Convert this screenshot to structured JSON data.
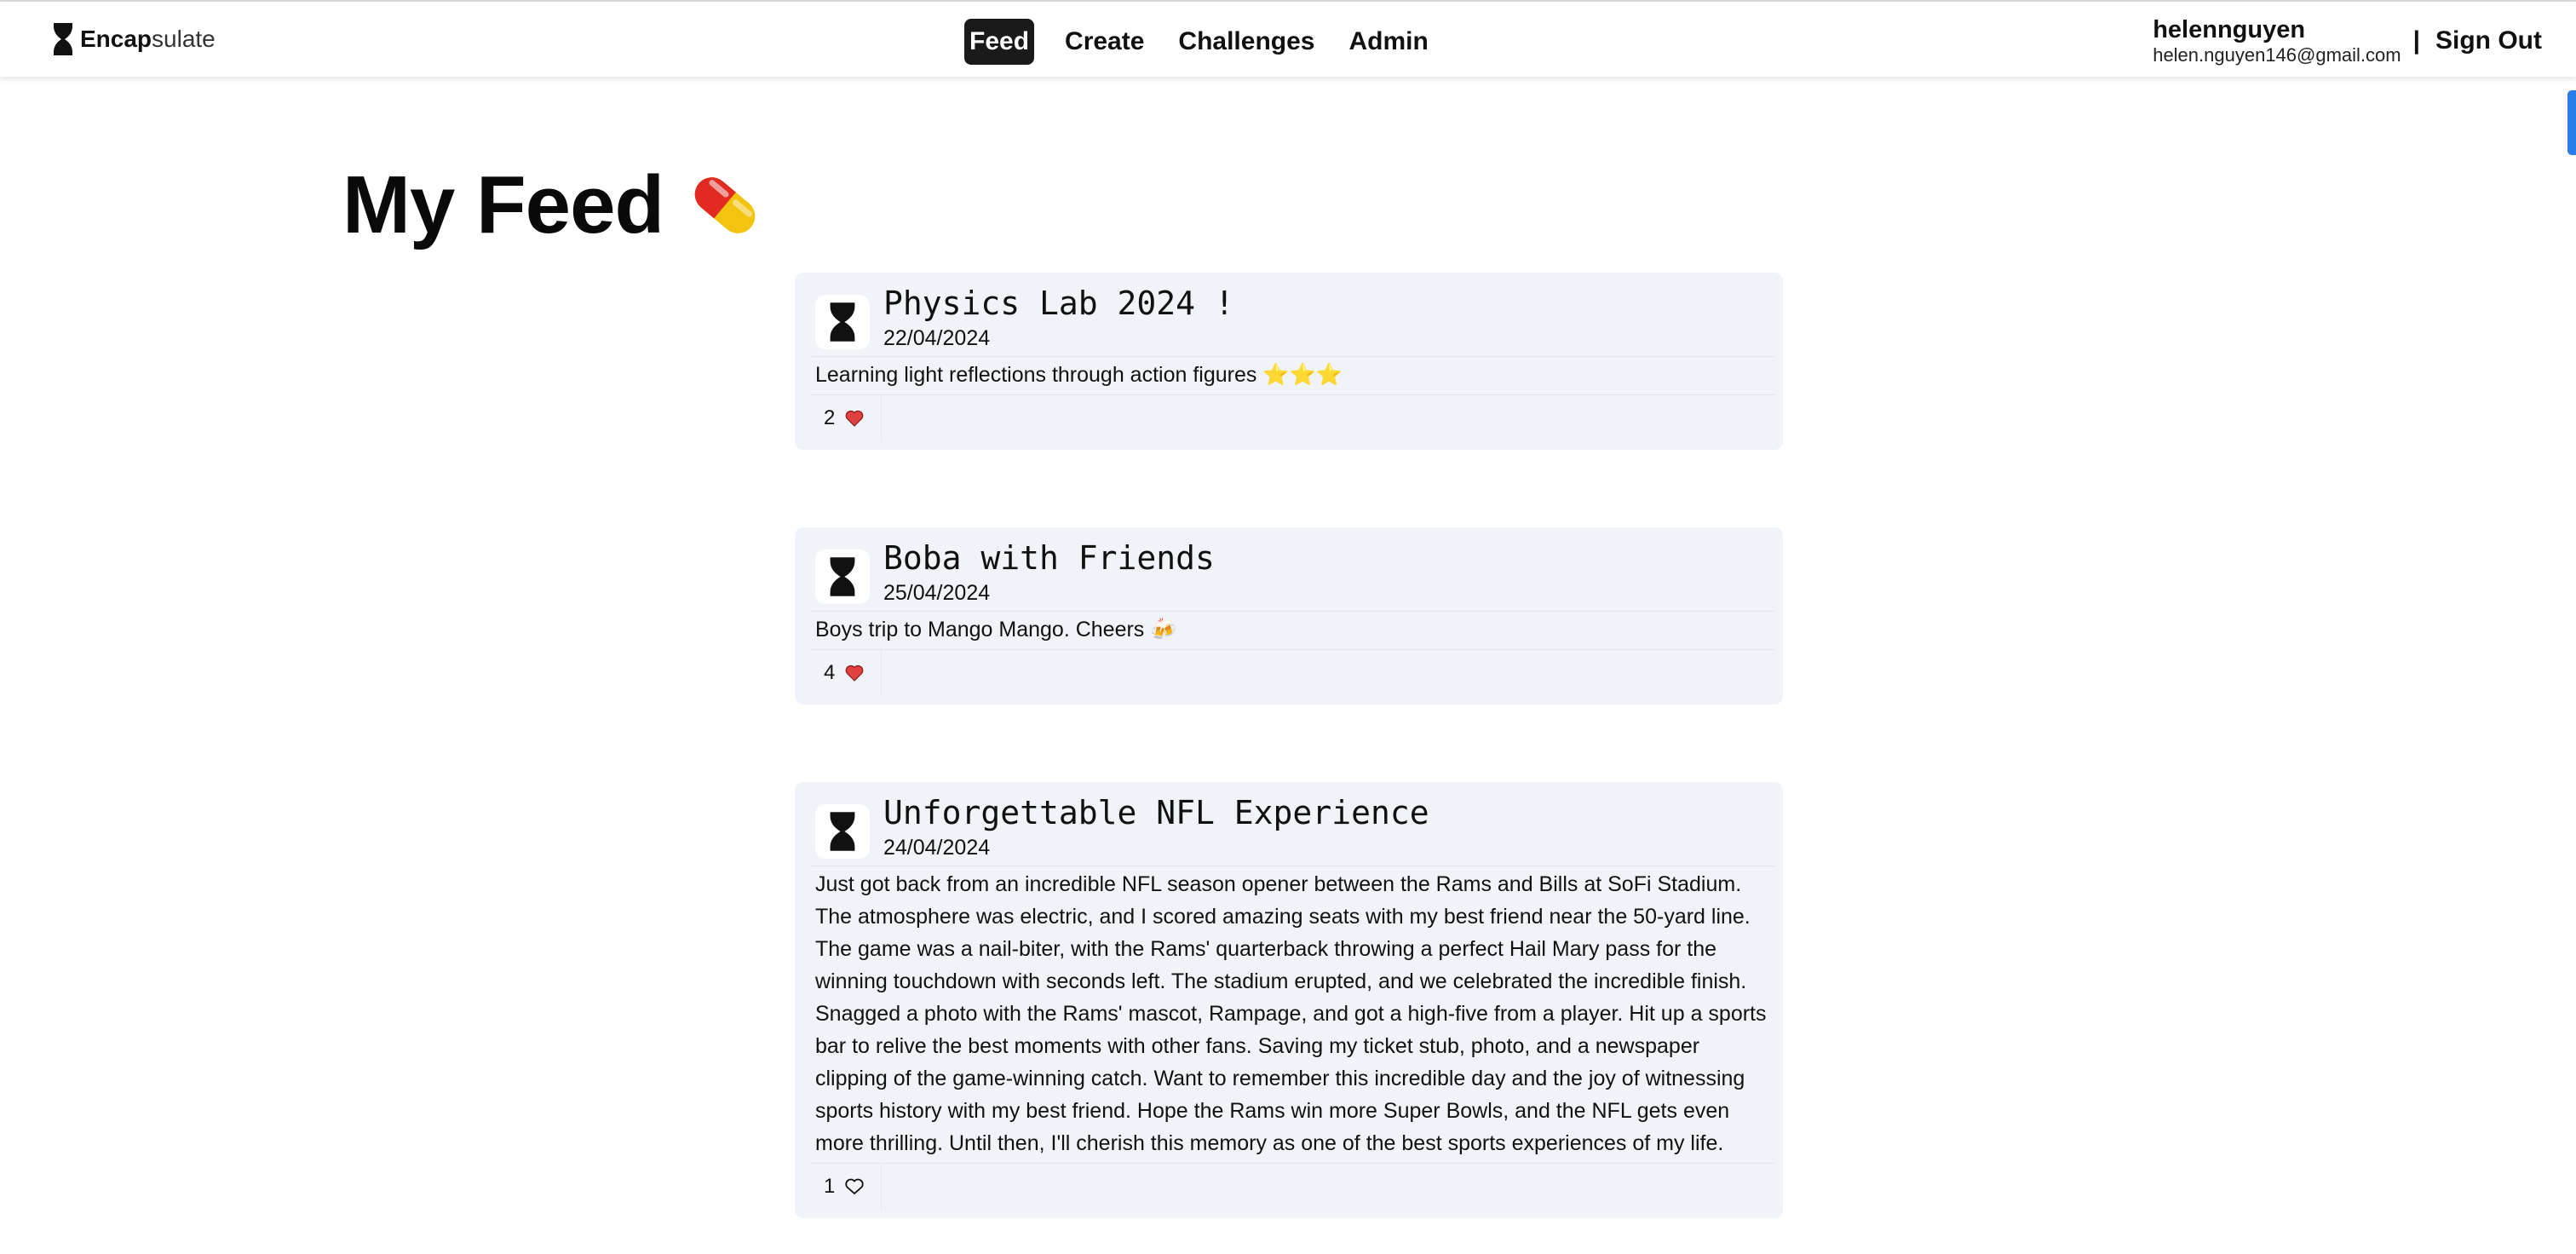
{
  "nav": {
    "brand_bold": "Encap",
    "brand_light": "sulate",
    "links": [
      "Feed",
      "Create",
      "Challenges",
      "Admin"
    ],
    "active": "Feed",
    "username": "helennguyen",
    "email": "helen.nguyen146@gmail.com",
    "divider": "|",
    "signout": "Sign Out"
  },
  "page": {
    "title": "My Feed",
    "title_icon": "pill-icon"
  },
  "posts": [
    {
      "title": "Physics Lab 2024 !",
      "date": "22/04/2024",
      "body": "Learning light reflections through action figures ⭐⭐⭐",
      "likes": "2",
      "liked": true
    },
    {
      "title": "Boba with Friends",
      "date": "25/04/2024",
      "body": "Boys trip to Mango Mango. Cheers 🍻",
      "likes": "4",
      "liked": true
    },
    {
      "title": "Unforgettable NFL Experience",
      "date": "24/04/2024",
      "body": "Just got back from an incredible NFL season opener between the Rams and Bills at SoFi Stadium. The atmosphere was electric, and I scored amazing seats with my best friend near the 50-yard line. The game was a nail-biter, with the Rams' quarterback throwing a perfect Hail Mary pass for the winning touchdown with seconds left. The stadium erupted, and we celebrated the incredible finish. Snagged a photo with the Rams' mascot, Rampage, and got a high-five from a player. Hit up a sports bar to relive the best moments with other fans. Saving my ticket stub, photo, and a newspaper clipping of the game-winning catch. Want to remember this incredible day and the joy of witnessing sports history with my best friend. Hope the Rams win more Super Bowls, and the NFL gets even more thrilling. Until then, I'll cherish this memory as one of the best sports experiences of my life.",
      "likes": "1",
      "liked": false
    }
  ],
  "colors": {
    "accent": "#1a1a1a",
    "card_bg": "#f0f3f8",
    "heart_liked": "#e0413f",
    "scroll_indicator": "#2b7de9"
  }
}
